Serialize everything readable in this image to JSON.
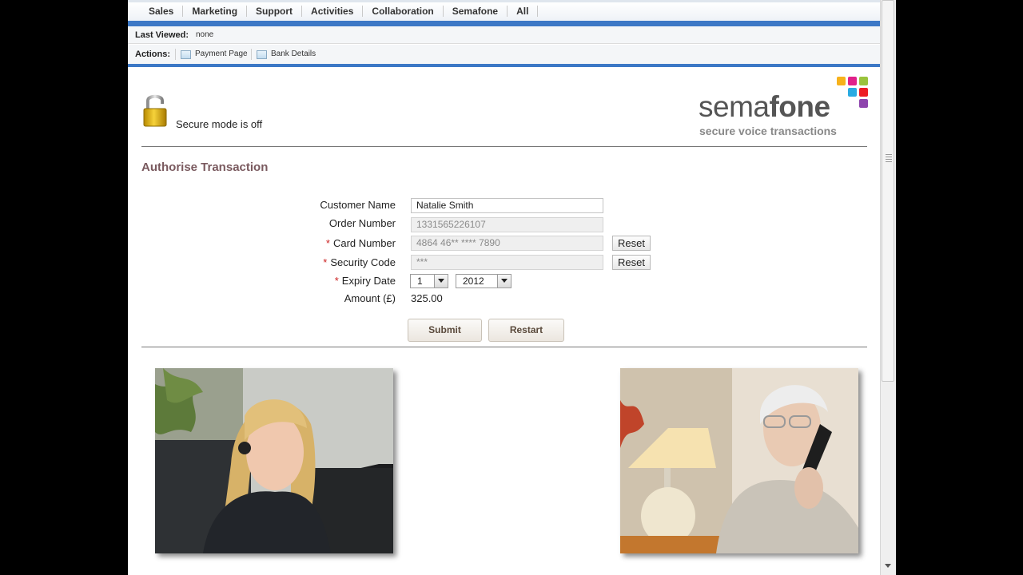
{
  "nav": {
    "tabs": [
      "Sales",
      "Marketing",
      "Support",
      "Activities",
      "Collaboration",
      "Semafone",
      "All"
    ]
  },
  "last_viewed": {
    "label": "Last Viewed:",
    "value": "none"
  },
  "actions": {
    "label": "Actions:",
    "items": [
      {
        "label": "Payment Page",
        "icon": "document-icon"
      },
      {
        "label": "Bank Details",
        "icon": "document-icon"
      }
    ]
  },
  "secure": {
    "status_text": "Secure mode is off",
    "icon": "unlocked-padlock-icon"
  },
  "logo": {
    "word_part1": "sema",
    "word_part2": "fone",
    "tagline": "secure voice transactions",
    "colors": [
      "#f7b21b",
      "#e0218a",
      "#9ac33c",
      "#29abe2",
      "#ed1c24",
      "#8e44ad"
    ]
  },
  "form": {
    "title": "Authorise Transaction",
    "customer_name": {
      "label": "Customer Name",
      "value": "Natalie Smith"
    },
    "order_number": {
      "label": "Order Number",
      "value": "1331565226107"
    },
    "card_number": {
      "label": "Card Number",
      "value": "4864 46** **** 7890",
      "required_mark": "*",
      "reset": "Reset"
    },
    "security_code": {
      "label": "Security Code",
      "value": "***",
      "required_mark": "*",
      "reset": "Reset"
    },
    "expiry_date": {
      "label": "Expiry Date",
      "required_mark": "*",
      "month": "1",
      "year": "2012"
    },
    "amount": {
      "label": "Amount (£)",
      "value": "325.00"
    },
    "submit": "Submit",
    "restart": "Restart"
  }
}
